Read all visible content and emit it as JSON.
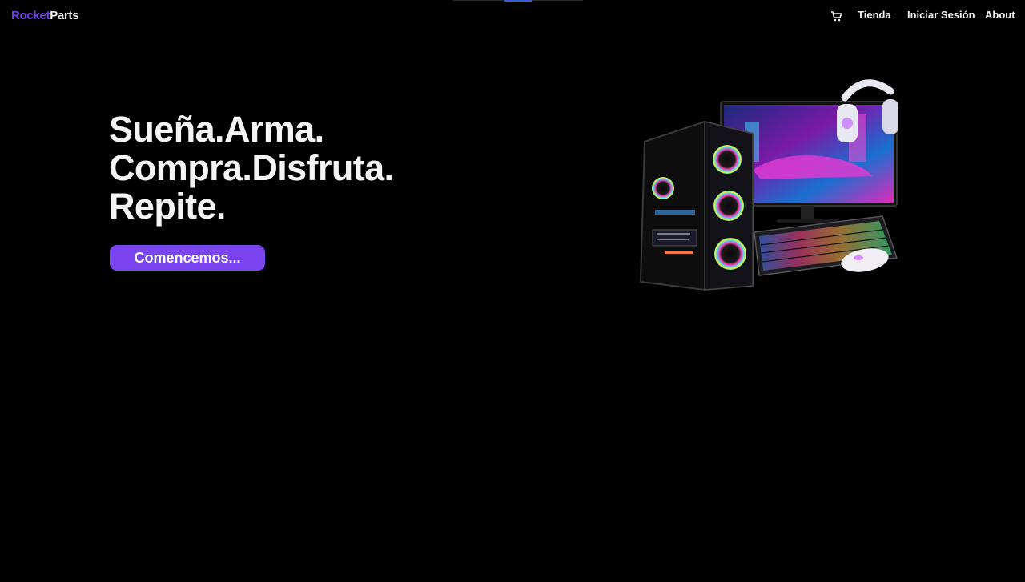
{
  "brand": {
    "part1": "Rocket",
    "part2": "Parts"
  },
  "nav": {
    "cart_icon": "cart-icon",
    "items": [
      {
        "label": "Tienda"
      },
      {
        "label": "Iniciar Sesión"
      },
      {
        "label": "About"
      }
    ]
  },
  "hero": {
    "lines": [
      "Sueña.Arma.",
      "Compra.Disfruta.",
      "Repite."
    ],
    "cta_label": "Comencemos..."
  },
  "colors": {
    "background": "#000000",
    "accent": "#7a45ee",
    "brand_accent": "#6d3fe6",
    "text": "#f4f4f4"
  }
}
